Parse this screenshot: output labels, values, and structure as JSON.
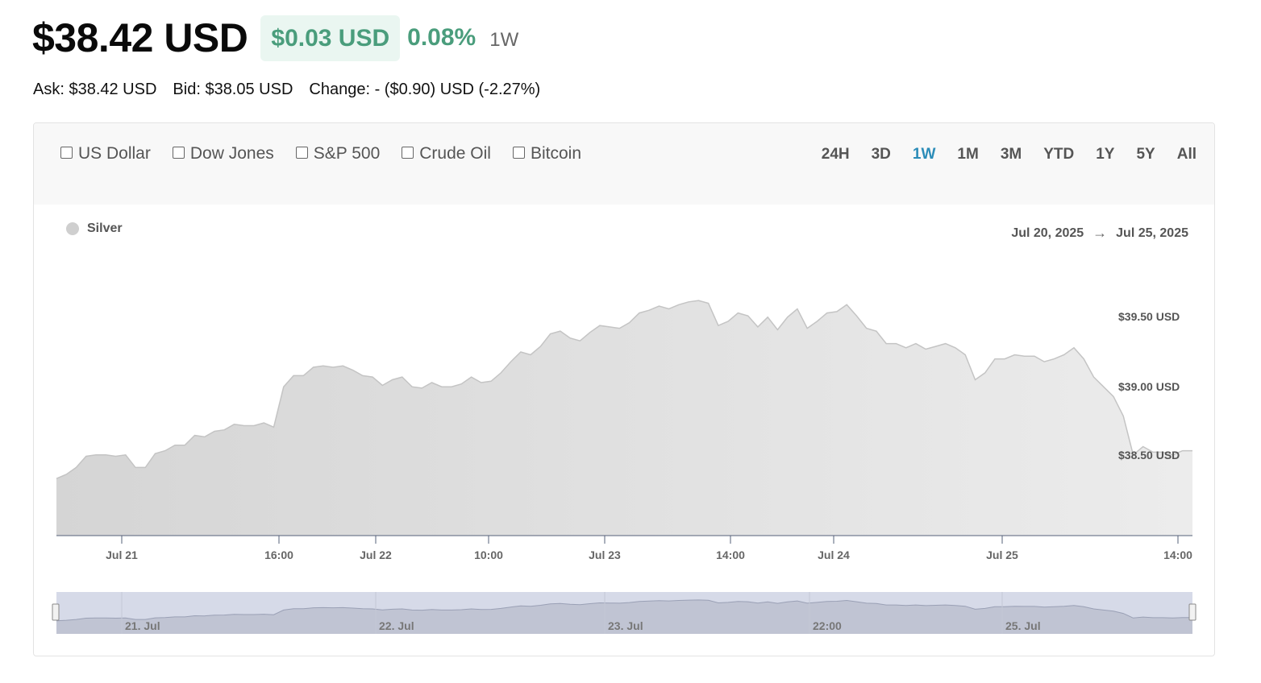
{
  "quote": {
    "price": "$38.42 USD",
    "change_amount": "$0.03 USD",
    "change_percent": "0.08%",
    "period": "1W",
    "ask": "Ask: $38.42 USD",
    "bid": "Bid: $38.05 USD",
    "change_range": "Change: - ($0.90) USD (-2.27%)",
    "positive_color": "#4a9d7c"
  },
  "compare": [
    {
      "label": "US Dollar",
      "checked": false
    },
    {
      "label": "Dow Jones",
      "checked": false
    },
    {
      "label": "S&P 500",
      "checked": false
    },
    {
      "label": "Crude Oil",
      "checked": false
    },
    {
      "label": "Bitcoin",
      "checked": false
    }
  ],
  "ranges": [
    "24H",
    "3D",
    "1W",
    "1M",
    "3M",
    "YTD",
    "1Y",
    "5Y",
    "All"
  ],
  "active_range": "1W",
  "accent_color": "#2b8cb8",
  "chart_data": {
    "type": "area",
    "series": [
      {
        "name": "Silver",
        "color": "#d2d2d2"
      }
    ],
    "date_from": "Jul 20, 2025",
    "date_to": "Jul 25, 2025",
    "y_ticks": [
      "$39.50 USD",
      "$39.00 USD",
      "$38.50 USD"
    ],
    "x_ticks": [
      "Jul 21",
      "16:00",
      "Jul 22",
      "10:00",
      "Jul 23",
      "14:00",
      "Jul 24",
      "Jul 25",
      "14:00"
    ],
    "navigator_ticks": [
      "21. Jul",
      "22. Jul",
      "23. Jul",
      "22:00",
      "25. Jul"
    ],
    "ylim": [
      37.95,
      39.93
    ],
    "values": [
      38.36,
      38.39,
      38.44,
      38.52,
      38.53,
      38.53,
      38.52,
      38.53,
      38.44,
      38.44,
      38.54,
      38.56,
      38.6,
      38.6,
      38.67,
      38.66,
      38.7,
      38.71,
      38.75,
      38.74,
      38.74,
      38.76,
      38.73,
      39.02,
      39.1,
      39.1,
      39.16,
      39.17,
      39.16,
      39.17,
      39.14,
      39.1,
      39.09,
      39.03,
      39.07,
      39.09,
      39.02,
      39.01,
      39.05,
      39.02,
      39.02,
      39.04,
      39.09,
      39.05,
      39.06,
      39.12,
      39.2,
      39.27,
      39.25,
      39.31,
      39.4,
      39.42,
      39.37,
      39.35,
      39.41,
      39.46,
      39.45,
      39.44,
      39.48,
      39.55,
      39.57,
      39.6,
      39.58,
      39.61,
      39.63,
      39.64,
      39.62,
      39.46,
      39.49,
      39.55,
      39.53,
      39.45,
      39.52,
      39.43,
      39.52,
      39.58,
      39.44,
      39.49,
      39.55,
      39.56,
      39.61,
      39.53,
      39.44,
      39.42,
      39.33,
      39.33,
      39.3,
      39.33,
      39.29,
      39.31,
      39.33,
      39.3,
      39.25,
      39.07,
      39.12,
      39.22,
      39.22,
      39.25,
      39.24,
      39.24,
      39.2,
      39.22,
      39.25,
      39.3,
      39.22,
      39.09,
      39.02,
      38.95,
      38.81,
      38.53,
      38.59,
      38.55,
      38.55,
      38.53,
      38.56,
      38.56
    ]
  }
}
